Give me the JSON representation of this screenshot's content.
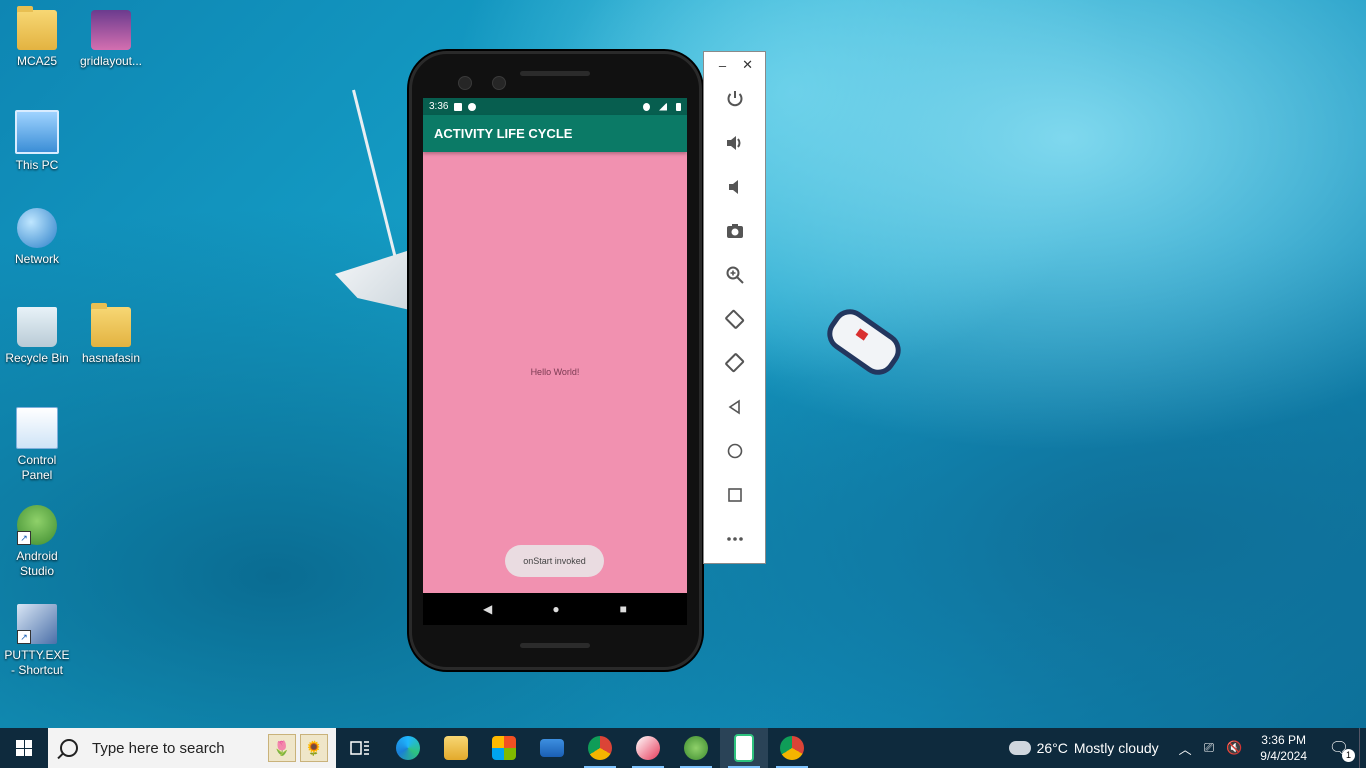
{
  "desktop": {
    "icons": [
      {
        "label": "MCA25"
      },
      {
        "label": "gridlayout..."
      },
      {
        "label": "This PC"
      },
      {
        "label": "Network"
      },
      {
        "label": "Recycle Bin"
      },
      {
        "label": "hasnafasin"
      },
      {
        "label": "Control Panel"
      },
      {
        "label": "Android Studio"
      },
      {
        "label": "PUTTY.EXE - Shortcut"
      }
    ]
  },
  "emulator": {
    "status_time": "3:36",
    "app_title": "ACTIVITY LIFE CYCLE",
    "hello_text": "Hello World!",
    "toast_text": "onStart invoked",
    "nav": {
      "back": "◀",
      "home": "●",
      "recents": "■"
    },
    "window_controls": {
      "minimize": "–",
      "close": "✕"
    },
    "toolbar": [
      "power",
      "volume-up",
      "volume-down",
      "camera",
      "zoom",
      "rotate-left",
      "rotate-right",
      "back",
      "home",
      "overview",
      "more"
    ]
  },
  "taskbar": {
    "search_placeholder": "Type here to search",
    "weather": {
      "temp": "26°C",
      "desc": "Mostly cloudy"
    },
    "clock": {
      "time": "3:36 PM",
      "date": "9/4/2024"
    },
    "notification_count": "1"
  },
  "colors": {
    "app_bar": "#0b7a66",
    "status_bar": "#075e4f",
    "screen_bg": "#f191b0",
    "taskbar": "#0e2a3d"
  }
}
